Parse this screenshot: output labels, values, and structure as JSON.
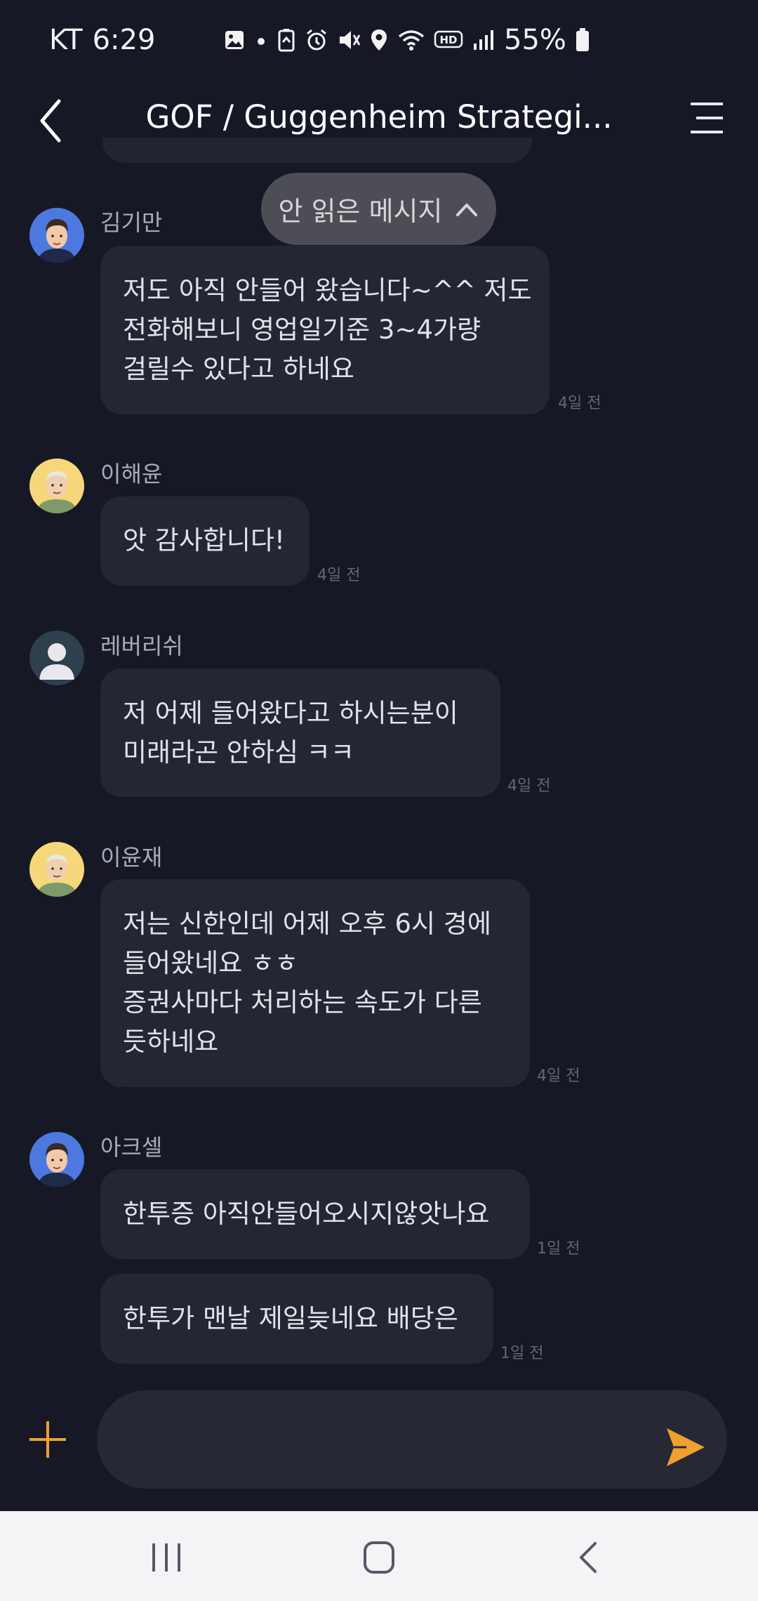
{
  "status_bar": {
    "carrier": "KT",
    "time": "6:29",
    "battery": "55%",
    "icons": [
      "gallery-icon",
      "dot-icon",
      "battery-saver-icon",
      "alarm-icon",
      "mute-icon",
      "location-icon",
      "wifi-icon",
      "hd-icon",
      "signal-icon",
      "battery-icon"
    ]
  },
  "header": {
    "title": "GOF / Guggenheim Strategi..."
  },
  "unread_pill": {
    "label": "안 읽은 메시지"
  },
  "messages": [
    {
      "sender": "김기만",
      "avatar": "cartoon-man-blue",
      "bubbles": [
        {
          "lines": [
            "저도 아직 안들어 왔습니다~^^ 저도",
            "전화해보니 영업일기준 3~4가량",
            "걸릴수 있다고 하네요"
          ],
          "time": "4일 전"
        }
      ]
    },
    {
      "sender": "이해윤",
      "avatar": "cartoon-elder-yellow",
      "bubbles": [
        {
          "lines": [
            "앗 감사합니다!"
          ],
          "time": "4일 전"
        }
      ]
    },
    {
      "sender": "레버리쉬",
      "avatar": "default-person",
      "bubbles": [
        {
          "lines": [
            "저 어제 들어왔다고 하시는분이",
            "미래라곤 안하심 ㅋㅋ"
          ],
          "time": "4일 전"
        }
      ]
    },
    {
      "sender": "이윤재",
      "avatar": "cartoon-elder-yellow",
      "bubbles": [
        {
          "lines": [
            "저는 신한인데 어제 오후 6시 경에",
            "들어왔네요 ㅎㅎ",
            "증권사마다 처리하는 속도가 다른",
            "듯하네요"
          ],
          "time": "4일 전"
        }
      ]
    },
    {
      "sender": "아크셀",
      "avatar": "cartoon-man-blue",
      "bubbles": [
        {
          "lines": [
            "한투증 아직안들어오시지않앗나요"
          ],
          "time": "1일 전"
        },
        {
          "lines": [
            "한투가 맨날 제일늦네요 배당은"
          ],
          "time": "1일 전"
        }
      ]
    }
  ],
  "composer": {
    "placeholder": ""
  },
  "colors": {
    "background": "#161826",
    "bubble": "#242633",
    "accent": "#f0a030",
    "navbar": "#f4f4f6"
  }
}
